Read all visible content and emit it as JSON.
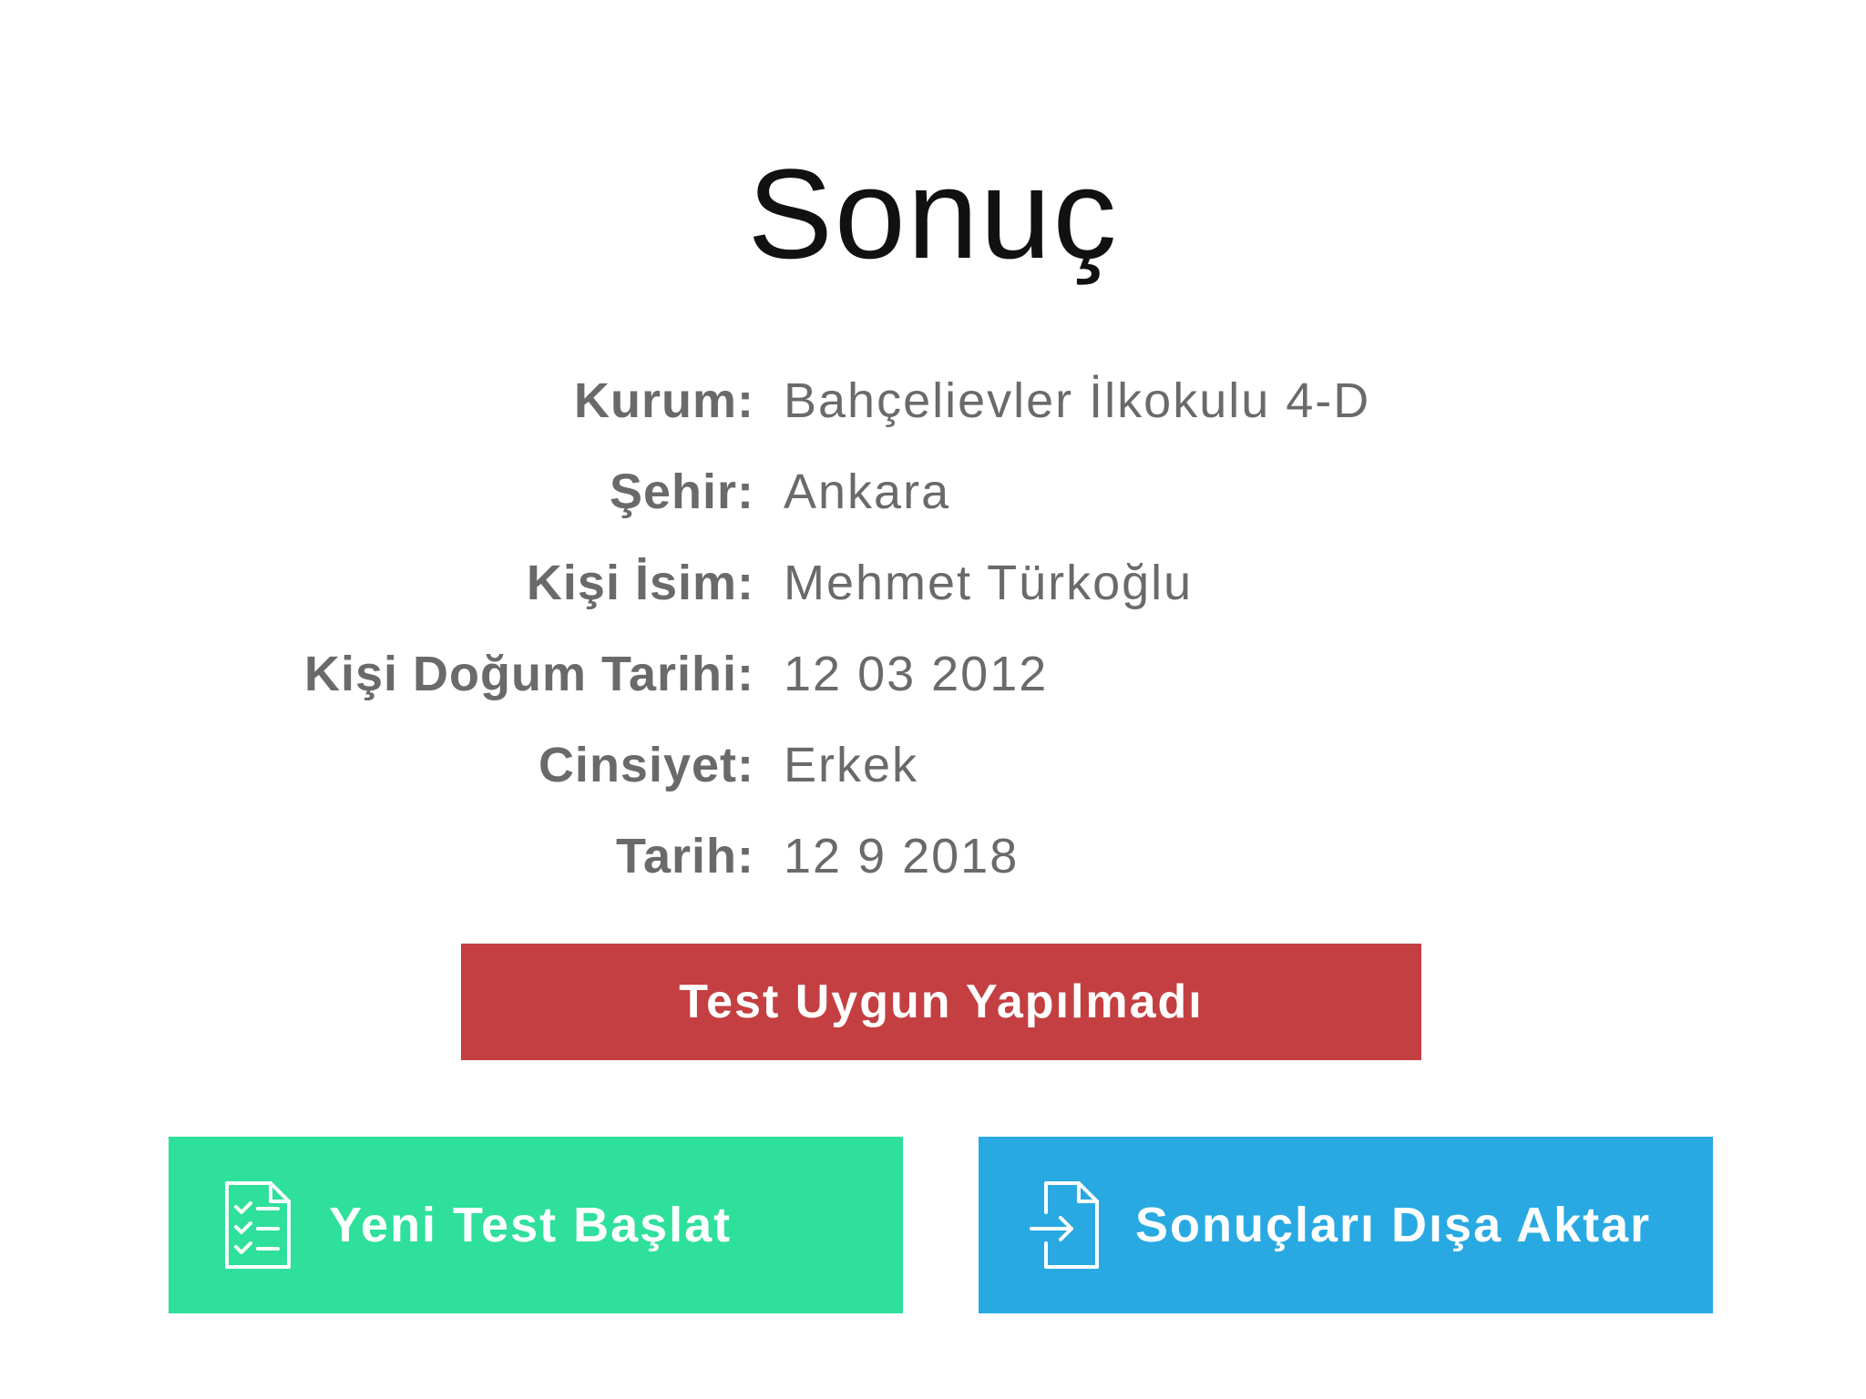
{
  "title": "Sonuç",
  "info": [
    {
      "label": "Kurum:",
      "value": "Bahçelievler İlkokulu 4-D"
    },
    {
      "label": "Şehir:",
      "value": "Ankara"
    },
    {
      "label": "Kişi İsim:",
      "value": "Mehmet Türkoğlu"
    },
    {
      "label": "Kişi Doğum Tarihi:",
      "value": "12 03 2012"
    },
    {
      "label": "Cinsiyet:",
      "value": "Erkek"
    },
    {
      "label": "Tarih:",
      "value": "12 9 2018"
    }
  ],
  "status": {
    "label": "Test Uygun Yapılmadı",
    "color": "#c43f41"
  },
  "actions": {
    "new_test": {
      "label": "Yeni Test Başlat",
      "icon": "checklist-icon",
      "color": "#2ee09b"
    },
    "export": {
      "label": "Sonuçları Dışa Aktar",
      "icon": "export-file-icon",
      "color": "#29a9e2"
    }
  }
}
